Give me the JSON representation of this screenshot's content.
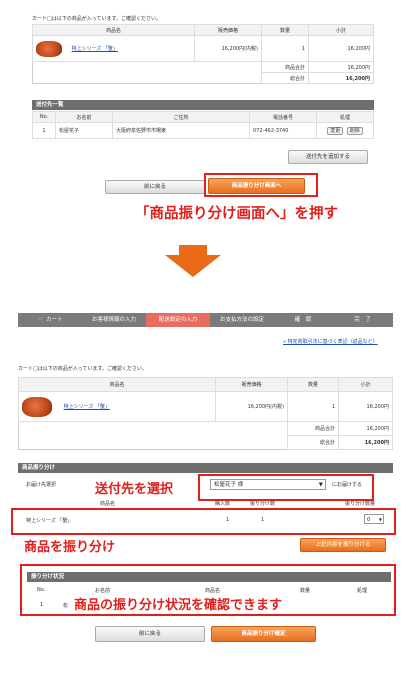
{
  "top_cart": {
    "note": "カート□は以下の商品が入っています。ご確認ください。",
    "headers": [
      "商品名",
      "販売価格",
      "数量",
      "小計"
    ],
    "item": {
      "name": "特上シリーズ 「蟹」",
      "price": "16,200円(内税)",
      "qty": "1",
      "subtotal": "16,200円"
    },
    "goods_total_label": "商品合計",
    "goods_total": "16,200円",
    "grand_total_label": "総合計",
    "grand_total": "16,200円"
  },
  "recipients": {
    "title": "送付先一覧",
    "headers": [
      "No.",
      "お名前",
      "ご住所",
      "電話番号",
      "処理"
    ],
    "row": {
      "no": "1",
      "name": "松屋花子",
      "address": "大阪府泉佐野市市場東",
      "phone": "072-462-3740",
      "edit": "変更",
      "delete": "削除"
    },
    "add_button": "送付先を追加する"
  },
  "top_buttons": {
    "back": "前に戻る",
    "next": "商品振り分け画面へ"
  },
  "annotation1": "「商品振り分け画面へ」を押す",
  "steps": {
    "cart": "カート",
    "customer": "お客様情報の入力",
    "shipping": "配送設定の入力",
    "payment": "お支払方法の設定",
    "confirm": "確　認",
    "done": "完　了"
  },
  "law_link": "» 特定商取引法に基づく表記（返品など）",
  "cart2": {
    "note": "カート□は以下の商品が入っています。ご確認ください。",
    "headers": [
      "商品名",
      "販売価格",
      "数量",
      "小計"
    ],
    "item": {
      "name": "特上シリーズ 「蟹」",
      "price": "16,200円(内税)",
      "qty": "1",
      "subtotal": "16,200円"
    },
    "goods_total_label": "商品合計",
    "goods_total": "16,200円",
    "grand_total_label": "総合計",
    "grand_total": "16,200円"
  },
  "allocation": {
    "title": "商品振り分け",
    "dest_label": "お届け先選択",
    "dest_value": "松屋花子 様",
    "dest_suffix": "にお届けする",
    "col_name": "商品名",
    "col_owned": "購入数",
    "col_assigned": "振り分け数",
    "col_qty": "振り分け数量",
    "row_name": "特上シリーズ 「蟹」",
    "row_owned": "1",
    "row_assigned": "1",
    "row_select": "0",
    "apply_button": "上記内容を振り分ける"
  },
  "annotation2": "送付先を選択",
  "annotation3": "商品を振り分け",
  "status": {
    "title": "振り分け状況",
    "headers": [
      "No.",
      "お名前",
      "商品名",
      "数量",
      "処理"
    ],
    "row_no": "1",
    "row_name": "松"
  },
  "annotation4": "商品の振り分け状況を確認できます",
  "bottom_buttons": {
    "back": "前に戻る",
    "confirm": "商品振り分け確定"
  }
}
